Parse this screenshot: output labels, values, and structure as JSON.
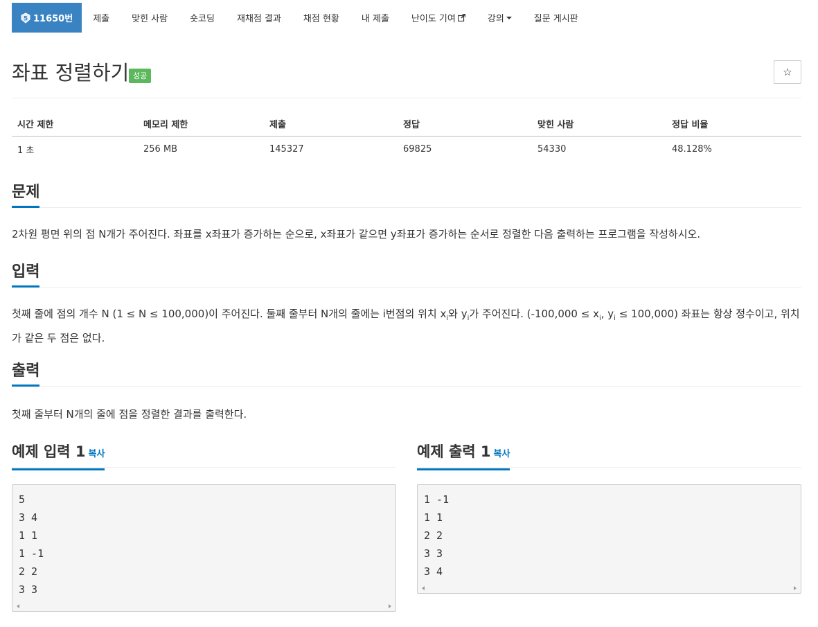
{
  "nav": {
    "problem_level": "5",
    "problem_id": "11650번",
    "items": [
      {
        "label": "제출"
      },
      {
        "label": "맞힌 사람"
      },
      {
        "label": "숏코딩"
      },
      {
        "label": "재채점 결과"
      },
      {
        "label": "채점 현황"
      },
      {
        "label": "내 제출"
      },
      {
        "label": "난이도 기여"
      },
      {
        "label": "강의"
      },
      {
        "label": "질문 게시판"
      }
    ]
  },
  "problem": {
    "title": "좌표 정렬하기",
    "status": "성공",
    "star": "☆"
  },
  "info_table": {
    "headers": [
      "시간 제한",
      "메모리 제한",
      "제출",
      "정답",
      "맞힌 사람",
      "정답 비율"
    ],
    "values": [
      "1 초",
      "256 MB",
      "145327",
      "69825",
      "54330",
      "48.128%"
    ]
  },
  "sections": {
    "description": {
      "title": "문제",
      "text": "2차원 평면 위의 점 N개가 주어진다. 좌표를 x좌표가 증가하는 순으로, x좌표가 같으면 y좌표가 증가하는 순서로 정렬한 다음 출력하는 프로그램을 작성하시오."
    },
    "input": {
      "title": "입력",
      "text_a": "첫째 줄에 점의 개수 N (1 ≤ N ≤ 100,000)이 주어진다. 둘째 줄부터 N개의 줄에는 i번점의 위치 x",
      "sub_i": "i",
      "text_b": "와 y",
      "text_c": "가 주어진다. (-100,000 ≤ x",
      "text_d": ", y",
      "text_e": " ≤ 100,000) 좌표는 항상 정수이고, 위치가 같은 두 점은 없다."
    },
    "output": {
      "title": "출력",
      "text": "첫째 줄부터 N개의 줄에 점을 정렬한 결과를 출력한다."
    }
  },
  "examples": {
    "copy_label": "복사",
    "input": {
      "title": "예제 입력 1",
      "content": "5\n3 4\n1 1\n1 -1\n2 2\n3 3"
    },
    "output": {
      "title": "예제 출력 1",
      "content": "1 -1\n1 1\n2 2\n3 3\n3 4"
    }
  },
  "colors": {
    "accent": "#3a83c3",
    "success": "#5cb85c",
    "link": "#0076c0"
  }
}
